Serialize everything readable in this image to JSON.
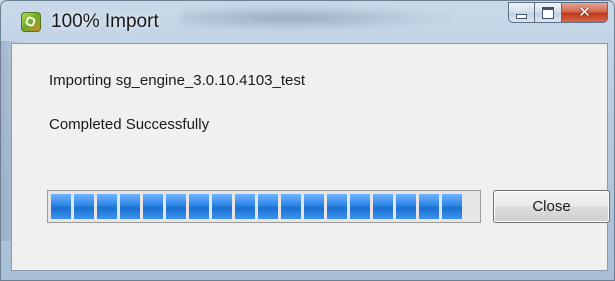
{
  "window": {
    "title": "100% Import",
    "icon": "import-app-icon"
  },
  "caption_buttons": {
    "minimize": "minimize-icon",
    "maximize": "maximize-icon",
    "close": "close-icon"
  },
  "dialog": {
    "importing_text": "Importing sg_engine_3.0.10.4103_test",
    "status_text": "Completed Successfully",
    "progress": 1.0,
    "close_label": "Close"
  },
  "colors": {
    "progress_fill": "#2e86e6",
    "close_caption": "#c0391f"
  }
}
